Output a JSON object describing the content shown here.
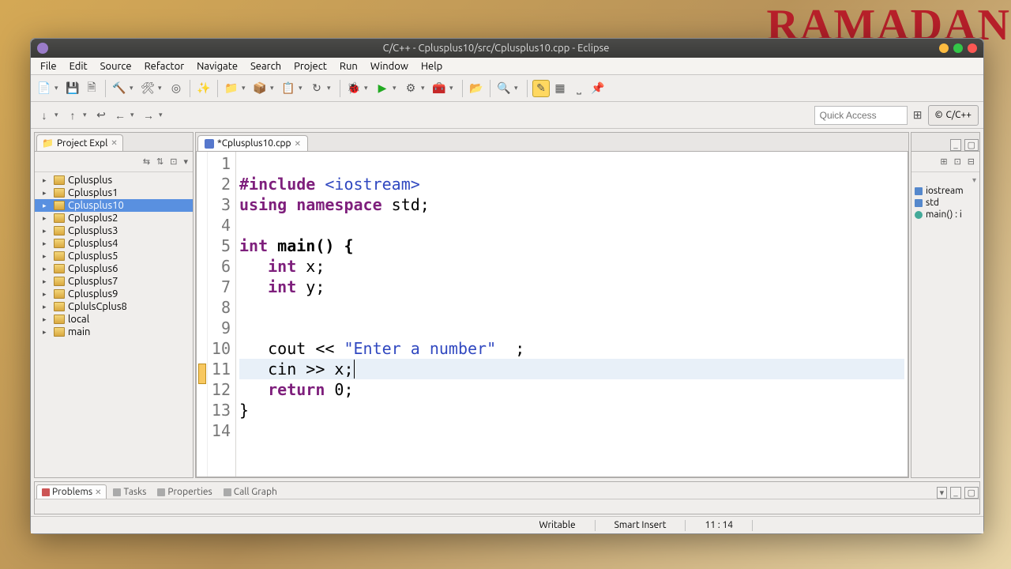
{
  "bg_text": "RAMADAN",
  "window": {
    "title": "C/C++ - Cplusplus10/src/Cplusplus10.cpp - Eclipse"
  },
  "menubar": [
    "File",
    "Edit",
    "Source",
    "Refactor",
    "Navigate",
    "Search",
    "Project",
    "Run",
    "Window",
    "Help"
  ],
  "quick_access_placeholder": "Quick Access",
  "perspective": "C/C++",
  "project_explorer": {
    "tab_label": "Project Expl",
    "items": [
      {
        "label": "Cplusplus",
        "selected": false
      },
      {
        "label": "Cplusplus1",
        "selected": false
      },
      {
        "label": "Cplusplus10",
        "selected": true
      },
      {
        "label": "Cplusplus2",
        "selected": false
      },
      {
        "label": "Cplusplus3",
        "selected": false
      },
      {
        "label": "Cplusplus4",
        "selected": false
      },
      {
        "label": "Cplusplus5",
        "selected": false
      },
      {
        "label": "Cplusplus6",
        "selected": false
      },
      {
        "label": "Cplusplus7",
        "selected": false
      },
      {
        "label": "Cplusplus9",
        "selected": false
      },
      {
        "label": "CplulsCplus8",
        "selected": false
      },
      {
        "label": "local",
        "selected": false
      },
      {
        "label": "main",
        "selected": false
      }
    ]
  },
  "editor": {
    "tab_label": "*Cplusplus10.cpp",
    "line_numbers": [
      "1",
      "2",
      "3",
      "4",
      "5",
      "6",
      "7",
      "8",
      "9",
      "10",
      "11",
      "12",
      "13",
      "14"
    ],
    "code": {
      "l2_include": "#include",
      "l2_header": "<iostream>",
      "l3_using": "using namespace",
      "l3_std": " std;",
      "l5_int": "int",
      "l5_main": " main() {",
      "l6_int": "int",
      "l6_x": " x;",
      "l7_int": "int",
      "l7_y": " y;",
      "l10_cout": "cout << ",
      "l10_str": "\"Enter a number\"",
      "l10_end": "  ;",
      "l11_cin": "cin >> x;",
      "l12_return": "return",
      "l12_zero": " 0;",
      "l13_brace": "}"
    }
  },
  "outline": {
    "items": [
      "iostream",
      "std",
      "main() : i"
    ]
  },
  "bottom_tabs": [
    "Problems",
    "Tasks",
    "Properties",
    "Call Graph"
  ],
  "statusbar": {
    "writable": "Writable",
    "insert": "Smart Insert",
    "pos": "11 : 14"
  }
}
